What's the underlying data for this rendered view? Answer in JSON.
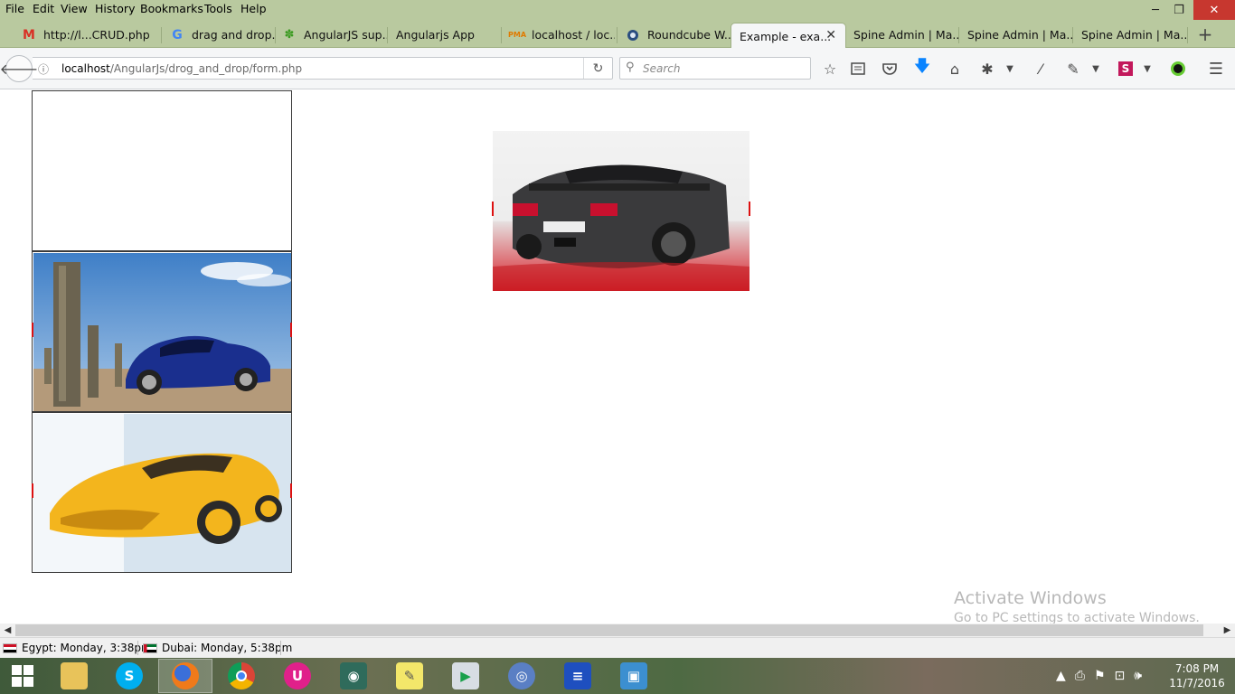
{
  "menubar": {
    "items": [
      "File",
      "Edit",
      "View",
      "History",
      "Bookmarks",
      "Tools",
      "Help"
    ],
    "window_controls": {
      "minimize": "─",
      "restore": "❐",
      "close": "✕"
    }
  },
  "tabs": [
    {
      "label": "http://l...CRUD.php",
      "icon": "gmail-icon"
    },
    {
      "label": "drag and drop...",
      "icon": "google-icon"
    },
    {
      "label": "AngularJS sup...",
      "icon": "paw-icon"
    },
    {
      "label": "Angularjs App",
      "icon": "page-icon"
    },
    {
      "label": "localhost / loc...",
      "icon": "phpmyadmin-icon"
    },
    {
      "label": "Roundcube W...",
      "icon": "roundcube-icon"
    },
    {
      "label": "Example - exa...",
      "icon": "none",
      "active": true
    },
    {
      "label": "Spine Admin | Ma...",
      "icon": "none"
    },
    {
      "label": "Spine Admin | Ma...",
      "icon": "none"
    },
    {
      "label": "Spine Admin | Ma...",
      "icon": "none"
    }
  ],
  "navbar": {
    "url_host": "localhost",
    "url_path": "/AngularJs/drog_and_drop/form.php",
    "search_placeholder": "Search"
  },
  "page": {
    "images": [
      {
        "name": "grey-sports-car",
        "location": "target"
      },
      {
        "name": "empty-slot",
        "location": "list"
      },
      {
        "name": "blue-roadster",
        "location": "list"
      },
      {
        "name": "yellow-supercar",
        "location": "list"
      }
    ]
  },
  "watermark": {
    "title": "Activate Windows",
    "subtitle": "Go to PC settings to activate Windows."
  },
  "statusbar": {
    "clocks": [
      {
        "label": "Egypt: Monday, 3:38pm",
        "flag": "egypt"
      },
      {
        "label": "Dubai: Monday, 5:38pm",
        "flag": "uae"
      }
    ]
  },
  "taskbar": {
    "time": "7:08 PM",
    "date": "11/7/2016"
  },
  "colors": {
    "chrome_bar": "#b9c99f",
    "toolbar": "#f5f6f7",
    "download_arrow": "#0a84ff"
  }
}
